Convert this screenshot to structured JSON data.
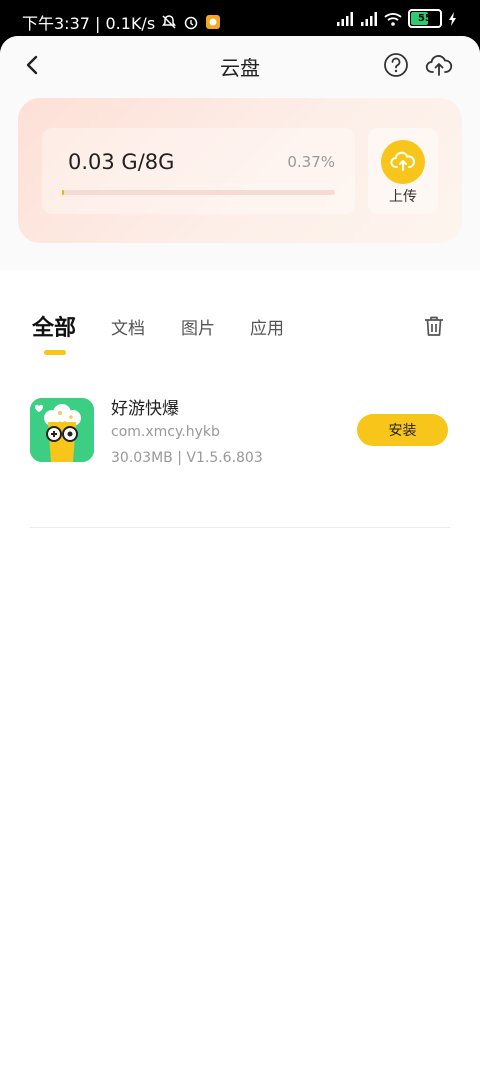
{
  "status_bar": {
    "time_speed": "下午3:37 | 0.1K/s",
    "battery": "55"
  },
  "nav": {
    "title": "云盘"
  },
  "storage": {
    "usage": "0.03 G/8G",
    "percent": "0.37%",
    "progress_fraction": 0.0037,
    "upload_label": "上传"
  },
  "tabs": [
    {
      "label": "全部",
      "active": true
    },
    {
      "label": "文档",
      "active": false
    },
    {
      "label": "图片",
      "active": false
    },
    {
      "label": "应用",
      "active": false
    }
  ],
  "files": [
    {
      "name": "好游快爆",
      "package": "com.xmcy.hykb",
      "meta": "30.03MB | V1.5.6.803",
      "action": "安装"
    }
  ],
  "colors": {
    "accent": "#f8c61a",
    "app_icon_bg": "#3ccf83"
  },
  "icons": {
    "back": "chevron-left-icon",
    "help": "question-circle-icon",
    "cloud": "cloud-upload-icon",
    "upload": "upload-arrow-icon",
    "trash": "trash-icon"
  }
}
